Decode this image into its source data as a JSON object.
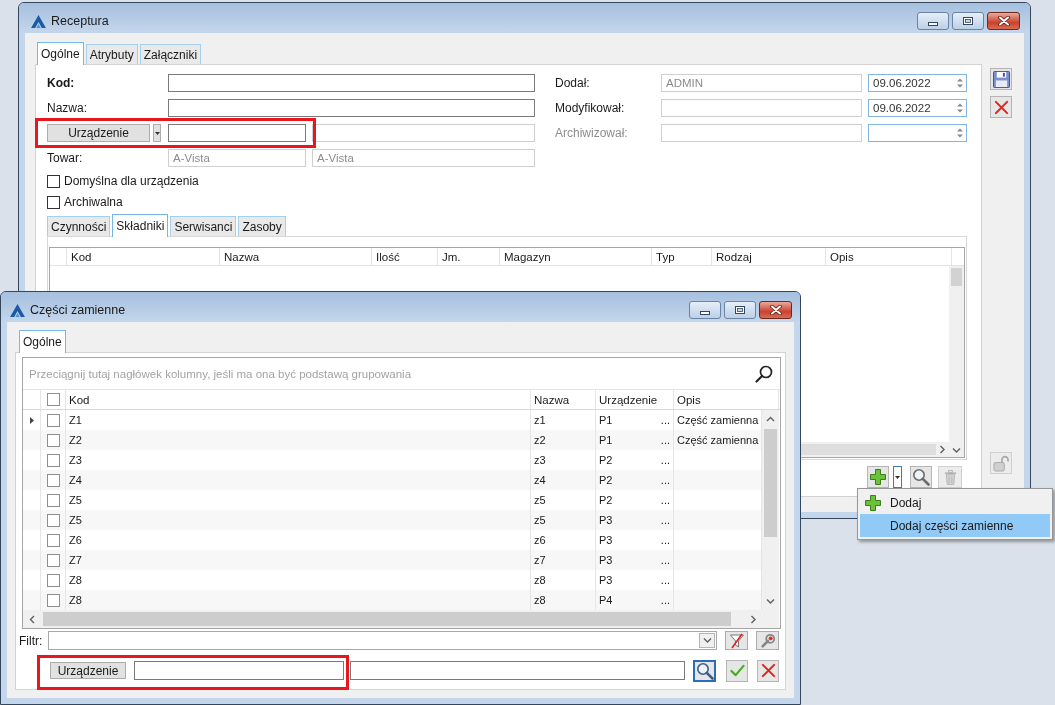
{
  "main_window": {
    "title": "Receptura",
    "tabs": [
      {
        "label": "Ogólne",
        "selected": true
      },
      {
        "label": "Atrybuty",
        "selected": false
      },
      {
        "label": "Załączniki",
        "selected": false
      }
    ],
    "form": {
      "code": {
        "label": "Kod:",
        "readonly": false
      },
      "name": {
        "label": "Nazwa:",
        "readonly": false
      },
      "device": {
        "button": "Urządzenie",
        "highlighted": true,
        "fields": [
          {
            "readonly": false
          },
          {
            "readonly": true
          }
        ]
      },
      "product": {
        "label": "Towar:",
        "fields": [
          {
            "value": "A-Vista",
            "readonly": true
          },
          {
            "value": "A-Vista",
            "readonly": true
          }
        ]
      },
      "checkboxes": [
        {
          "label": "Domyślna dla urządzenia",
          "checked": false
        },
        {
          "label": "Archiwalna",
          "checked": false
        }
      ],
      "audit": [
        {
          "label": "Dodał:",
          "user": "ADMIN",
          "date": "09.06.2022",
          "disabled": false
        },
        {
          "label": "Modyfikował:",
          "date": "09.06.2022",
          "disabled": false
        },
        {
          "label": "Archiwizował:",
          "disabled": true
        }
      ]
    },
    "subtabs": [
      {
        "label": "Czynności",
        "selected": false
      },
      {
        "label": "Składniki",
        "selected": true
      },
      {
        "label": "Serwisanci",
        "selected": false
      },
      {
        "label": "Zasoby",
        "selected": false
      }
    ],
    "grid": {
      "columns": [
        "Kod",
        "Nazwa",
        "Ilość",
        "Jm.",
        "Magazyn",
        "Typ",
        "Rodzaj",
        "Opis"
      ]
    },
    "toolbar": [
      {
        "kind": "add",
        "disabled": false
      },
      {
        "kind": "dropdown",
        "disabled": false
      },
      {
        "kind": "search",
        "disabled": false
      },
      {
        "kind": "delete",
        "disabled": true
      }
    ],
    "side_buttons": [
      {
        "kind": "save",
        "disabled": false
      },
      {
        "kind": "cancel",
        "disabled": false
      },
      {
        "kind": "lock",
        "disabled": true
      }
    ]
  },
  "dropdown_menu": {
    "items": [
      {
        "kind": "add",
        "label": "Dodaj",
        "selected": false
      },
      {
        "kind": "text",
        "label": "Dodaj części zamienne",
        "selected": true
      }
    ]
  },
  "parts_window": {
    "title": "Części zamienne",
    "tabs": [
      {
        "label": "Ogólne",
        "selected": true
      }
    ],
    "group_hint": "Przeciągnij tutaj nagłówek kolumny, jeśli ma ona być podstawą grupowania",
    "header_checkbox": {
      "checked": false
    },
    "columns": [
      "Kod",
      "Nazwa",
      "Urządzenie",
      "Opis"
    ],
    "rows": [
      {
        "code": "Z1",
        "name": "z1",
        "device": "P1",
        "lookup": "...",
        "description": "Część zamienna",
        "checked": false,
        "selected": true
      },
      {
        "code": "Z2",
        "name": "z2",
        "device": "P1",
        "lookup": "...",
        "description": "Część zamienna",
        "checked": false,
        "selected": false
      },
      {
        "code": "Z3",
        "name": "z3",
        "device": "P2",
        "lookup": "...",
        "checked": false,
        "selected": false
      },
      {
        "code": "Z4",
        "name": "z4",
        "device": "P2",
        "lookup": "...",
        "checked": false,
        "selected": false
      },
      {
        "code": "Z5",
        "name": "z5",
        "device": "P2",
        "lookup": "...",
        "checked": false,
        "selected": false
      },
      {
        "code": "Z5",
        "name": "z5",
        "device": "P3",
        "lookup": "...",
        "checked": false,
        "selected": false
      },
      {
        "code": "Z6",
        "name": "z6",
        "device": "P3",
        "lookup": "...",
        "checked": false,
        "selected": false
      },
      {
        "code": "Z7",
        "name": "z7",
        "device": "P3",
        "lookup": "...",
        "checked": false,
        "selected": false
      },
      {
        "code": "Z8",
        "name": "z8",
        "device": "P3",
        "lookup": "...",
        "checked": false,
        "selected": false
      },
      {
        "code": "Z8",
        "name": "z8",
        "device": "P4",
        "lookup": "...",
        "checked": false,
        "selected": false
      }
    ],
    "filter": {
      "label": "Filtr:"
    },
    "device_filter": {
      "button": "Urządzenie",
      "highlighted": true
    }
  }
}
